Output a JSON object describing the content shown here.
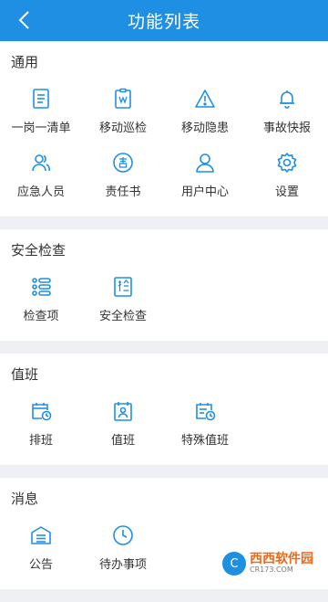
{
  "header": {
    "title": "功能列表",
    "background": "#1f8fe3"
  },
  "icon_color": "#1f8fe3",
  "sections": [
    {
      "title": "通用",
      "items": [
        {
          "label": "一岗一清单",
          "icon": "list-icon"
        },
        {
          "label": "移动巡检",
          "icon": "patrol-icon"
        },
        {
          "label": "移动隐患",
          "icon": "warning-icon"
        },
        {
          "label": "事故快报",
          "icon": "bell-icon"
        },
        {
          "label": "应急人员",
          "icon": "people-icon"
        },
        {
          "label": "责任书",
          "icon": "responsibility-icon"
        },
        {
          "label": "用户中心",
          "icon": "user-icon"
        },
        {
          "label": "设置",
          "icon": "gear-icon"
        }
      ]
    },
    {
      "title": "安全检查",
      "items": [
        {
          "label": "检查项",
          "icon": "checklist-icon"
        },
        {
          "label": "安全检查",
          "icon": "inspect-icon"
        }
      ]
    },
    {
      "title": "值班",
      "items": [
        {
          "label": "排班",
          "icon": "calendar-clock-icon"
        },
        {
          "label": "值班",
          "icon": "calendar-person-icon"
        },
        {
          "label": "特殊值班",
          "icon": "calendar-special-icon"
        }
      ]
    },
    {
      "title": "消息",
      "items": [
        {
          "label": "公告",
          "icon": "notice-icon"
        },
        {
          "label": "待办事项",
          "icon": "clock-icon"
        }
      ]
    }
  ],
  "watermark": {
    "logo": "C",
    "name": "西西软件园",
    "url": "CR173.COM"
  }
}
